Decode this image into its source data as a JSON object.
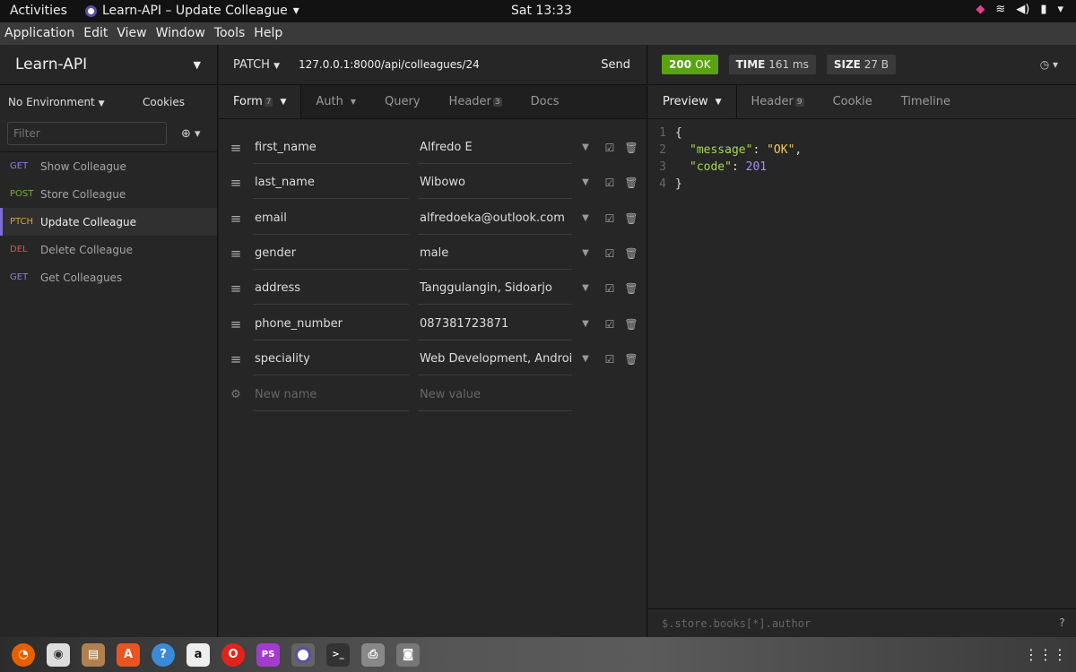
{
  "topbar": {
    "activities": "Activities",
    "app_indicator": "Learn-API – Update Colleague",
    "clock": "Sat 13:33"
  },
  "menubar": [
    "Application",
    "Edit",
    "View",
    "Window",
    "Tools",
    "Help"
  ],
  "sidebar": {
    "workspace": "Learn-API",
    "environment": "No Environment",
    "cookies": "Cookies",
    "filter_placeholder": "Filter",
    "requests": [
      {
        "method": "GET",
        "name": "Show Colleague",
        "color": "#8a7fe0"
      },
      {
        "method": "POST",
        "name": "Store Colleague",
        "color": "#71b33b"
      },
      {
        "method": "PTCH",
        "name": "Update Colleague",
        "color": "#d8a13b"
      },
      {
        "method": "DEL",
        "name": "Delete Colleague",
        "color": "#e05252"
      },
      {
        "method": "GET",
        "name": "Get Colleagues",
        "color": "#8a7fe0"
      }
    ]
  },
  "request": {
    "method": "PATCH",
    "url": "127.0.0.1:8000/api/colleagues/24",
    "send": "Send",
    "tabs": [
      {
        "label": "Form",
        "count": "7"
      },
      {
        "label": "Auth",
        "count": ""
      },
      {
        "label": "Query",
        "count": ""
      },
      {
        "label": "Header",
        "count": "3"
      },
      {
        "label": "Docs",
        "count": ""
      }
    ],
    "params": [
      {
        "name": "first_name",
        "value": "Alfredo E"
      },
      {
        "name": "last_name",
        "value": "Wibowo"
      },
      {
        "name": "email",
        "value": "alfredoeka@outlook.com"
      },
      {
        "name": "gender",
        "value": "male"
      },
      {
        "name": "address",
        "value": "Tanggulangin, Sidoarjo"
      },
      {
        "name": "phone_number",
        "value": "087381723871"
      },
      {
        "name": "speciality",
        "value": "Web Development, Android"
      }
    ],
    "new_name_placeholder": "New name",
    "new_value_placeholder": "New value"
  },
  "response": {
    "status_code": "200",
    "status_text": "OK",
    "time_label": "TIME",
    "time_value": "161 ms",
    "size_label": "SIZE",
    "size_value": "27 B",
    "tabs": [
      {
        "label": "Preview",
        "count": ""
      },
      {
        "label": "Header",
        "count": "9"
      },
      {
        "label": "Cookie",
        "count": ""
      },
      {
        "label": "Timeline",
        "count": ""
      }
    ],
    "body_lines": [
      {
        "num": "1",
        "parts": [
          {
            "cls": "",
            "text": "{"
          }
        ]
      },
      {
        "num": "2",
        "parts": [
          {
            "cls": "key",
            "text": "\"message\""
          },
          {
            "cls": "",
            "text": ": "
          },
          {
            "cls": "str",
            "text": "\"OK\""
          },
          {
            "cls": "",
            "text": ","
          }
        ]
      },
      {
        "num": "3",
        "parts": [
          {
            "cls": "key",
            "text": "\"code\""
          },
          {
            "cls": "",
            "text": ": "
          },
          {
            "cls": "num",
            "text": "201"
          }
        ]
      },
      {
        "num": "4",
        "parts": [
          {
            "cls": "",
            "text": "}"
          }
        ]
      }
    ],
    "query_placeholder": "$.store.books[*].author"
  },
  "taskbar": [
    {
      "name": "firefox-icon",
      "glyph": "🦊",
      "color": "#e66000"
    },
    {
      "name": "disk-icon",
      "glyph": "◉",
      "color": "#ccc"
    },
    {
      "name": "files-icon",
      "glyph": "▤",
      "color": "#b08050"
    },
    {
      "name": "software-center-icon",
      "glyph": "A",
      "color": "#e95420"
    },
    {
      "name": "help-icon",
      "glyph": "?",
      "color": "#3a8ad8"
    },
    {
      "name": "amazon-icon",
      "glyph": "a",
      "color": "#eee"
    },
    {
      "name": "opera-icon",
      "glyph": "O",
      "color": "#e0241b"
    },
    {
      "name": "phpstorm-icon",
      "glyph": "PS",
      "color": "#a33ccd"
    },
    {
      "name": "insomnia-icon",
      "glyph": "◐",
      "color": "#5e4ba8"
    },
    {
      "name": "terminal-icon",
      "glyph": ">_",
      "color": "#333"
    },
    {
      "name": "printer-icon",
      "glyph": "⎙",
      "color": "#888"
    },
    {
      "name": "camera-icon",
      "glyph": "◙",
      "color": "#777"
    }
  ]
}
